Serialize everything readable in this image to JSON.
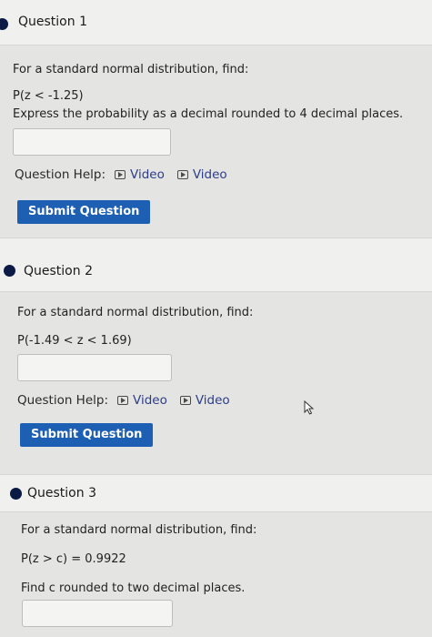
{
  "questions": [
    {
      "title": "Question 1",
      "prompt": "For a standard normal distribution, find:",
      "expression": "P(z < -1.25)",
      "instruction": "Express the probability as a decimal rounded to 4 decimal places.",
      "answer_value": "",
      "help_label": "Question Help:",
      "video_links": [
        "Video",
        "Video"
      ],
      "submit_label": "Submit Question"
    },
    {
      "title": "Question 2",
      "prompt": "For a standard normal distribution, find:",
      "expression": "P(-1.49 < z < 1.69)",
      "answer_value": "",
      "help_label": "Question Help:",
      "video_links": [
        "Video",
        "Video"
      ],
      "submit_label": "Submit Question"
    },
    {
      "title": "Question 3",
      "prompt": "For a standard normal distribution, find:",
      "expression": "P(z > c) = 0.9922",
      "instruction": "Find c rounded to two decimal places.",
      "answer_value": ""
    }
  ],
  "icons": {
    "bullet": "filled-circle",
    "video": "play-icon",
    "cursor": "mouse-pointer-icon"
  },
  "colors": {
    "bullet": "#0b1a44",
    "submit_button": "#1d5fb3",
    "link": "#2d3d8a"
  }
}
